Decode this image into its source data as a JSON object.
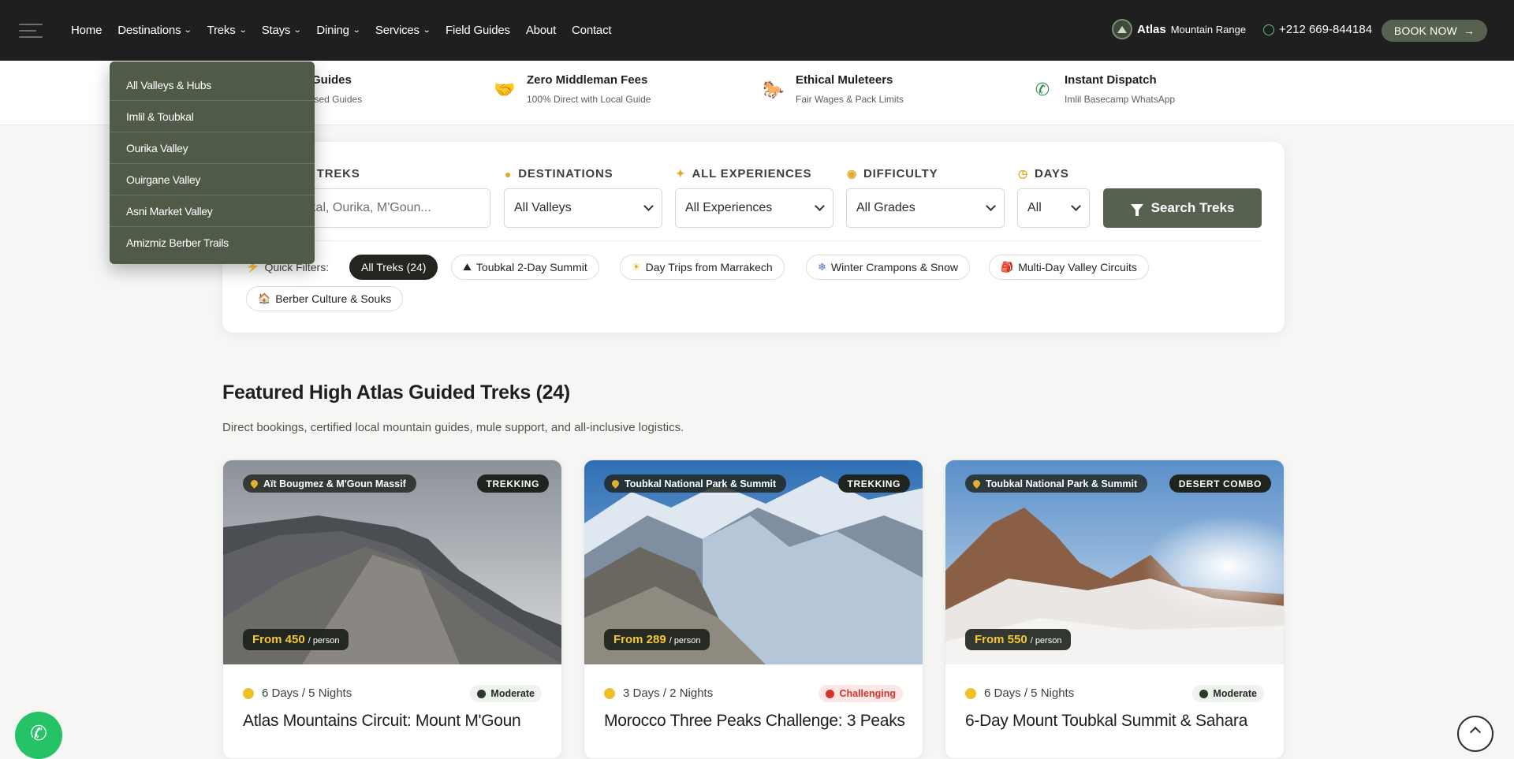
{
  "nav": {
    "links": [
      {
        "label": "Home",
        "has_dropdown": false
      },
      {
        "label": "Destinations",
        "has_dropdown": true
      },
      {
        "label": "Treks",
        "has_dropdown": true
      },
      {
        "label": "Stays",
        "has_dropdown": true
      },
      {
        "label": "Dining",
        "has_dropdown": true
      },
      {
        "label": "Services",
        "has_dropdown": true
      },
      {
        "label": "Field Guides",
        "has_dropdown": false
      },
      {
        "label": "About",
        "has_dropdown": false
      },
      {
        "label": "Contact",
        "has_dropdown": false
      }
    ],
    "chevron": "⌄",
    "brand_bold": "Atlas",
    "brand_light": "Mountain Range",
    "phone": "+212 669-844184",
    "book_label": "BOOK NOW",
    "book_arrow": "→"
  },
  "destinations_dropdown": {
    "items": [
      "All Valleys & Hubs",
      "Imlil & Toubkal",
      "Ourika Valley",
      "Ouirgane Valley",
      "Asni Market Valley",
      "Amizmiz Berber Trails"
    ]
  },
  "trust_bar": [
    {
      "icon": "medal-icon",
      "glyph": "🎖",
      "title": "Certified Guides",
      "sub": "Official Licensed Guides"
    },
    {
      "icon": "handshake-icon",
      "glyph": "🤝",
      "title": "Zero Middleman Fees",
      "sub": "100% Direct with Local Guide"
    },
    {
      "icon": "horse-icon",
      "glyph": "🐎",
      "title": "Ethical Muleteers",
      "sub": "Fair Wages & Pack Limits"
    },
    {
      "icon": "whatsapp-icon",
      "glyph": "✆",
      "title": "Instant Dispatch",
      "sub": "Imlil Basecamp WhatsApp"
    }
  ],
  "search": {
    "keyword_label": "SEARCH TREKS",
    "keyword_placeholder": "e.g. Toubkal, Ourika, M'Goun...",
    "destinations_label": "DESTINATIONS",
    "destinations_value": "All Valleys",
    "experiences_label": "ALL EXPERIENCES",
    "experiences_value": "All Experiences",
    "difficulty_label": "DIFFICULTY",
    "difficulty_value": "All Grades",
    "days_label": "DAYS",
    "days_value": "All",
    "button_label": "Search Treks"
  },
  "quick_filters": {
    "label": "Quick Filters:",
    "chips": [
      {
        "label": "All Treks (24)",
        "glyph": "",
        "active": true
      },
      {
        "label": "Toubkal 2-Day Summit",
        "glyph": "⛰",
        "active": false
      },
      {
        "label": "Day Trips from Marrakech",
        "glyph": "☀",
        "active": false
      },
      {
        "label": "Winter Crampons & Snow",
        "glyph": "❄",
        "active": false
      },
      {
        "label": "Multi-Day Valley Circuits",
        "glyph": "🎒",
        "active": false
      },
      {
        "label": "Berber Culture & Souks",
        "glyph": "🏠",
        "active": false
      }
    ]
  },
  "section": {
    "title": "Featured High Atlas Guided Treks (24)",
    "subtitle": "Direct bookings, certified local mountain guides, mule support, and all-inclusive logistics."
  },
  "cards": [
    {
      "location": "Aït Bougmez & M'Goun Massif",
      "type": "TREKKING",
      "price": "From 450",
      "per": "/ person",
      "duration": "6 Days / 5 Nights",
      "difficulty": "Moderate",
      "title": "Atlas Mountains Circuit: Mount M'Goun"
    },
    {
      "location": "Toubkal National Park & Summit",
      "type": "TREKKING",
      "price": "From 289",
      "per": "/ person",
      "duration": "3 Days / 2 Nights",
      "difficulty": "Challenging",
      "title": "Morocco Three Peaks Challenge: 3 Peaks"
    },
    {
      "location": "Toubkal National Park & Summit",
      "type": "DESERT COMBO",
      "price": "From 550",
      "per": "/ person",
      "duration": "6 Days / 5 Nights",
      "difficulty": "Moderate",
      "title": "6-Day Mount Toubkal Summit & Sahara"
    }
  ],
  "colors": {
    "accent": "#56614f",
    "nav_bg": "#1e1f1e",
    "gold": "#e1a924",
    "price_yellow": "#f3c834",
    "challenging_red": "#d3342d"
  }
}
